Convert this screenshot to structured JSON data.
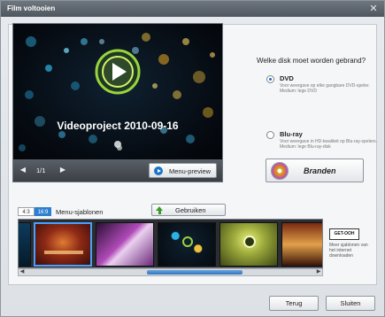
{
  "window": {
    "title": "Film voltooien",
    "close_glyph": "✕"
  },
  "preview": {
    "project_title": "Videoproject 2010-09-16",
    "page_counter": "1/1",
    "prev_glyph": "◀",
    "next_glyph": "▶",
    "menu_preview_label": "Menu-preview"
  },
  "disc": {
    "question": "Welke disk moet worden gebrand?",
    "options": [
      {
        "label": "DVD",
        "selected": true,
        "description": "Voor weergave op elke gangbare DVD-speler. Medium: lege DVD"
      },
      {
        "label": "Blu-ray",
        "selected": false,
        "description": "Voor weergave in HD-kwaliteit op Blu-ray-spelers. Medium: lege Blu-ray-disk"
      }
    ],
    "burn_label": "Branden"
  },
  "templates": {
    "aspect_43": "4:3",
    "aspect_169": "16:9",
    "label": "Menu-sjablonen",
    "use_label": "Gebruiken",
    "get_more_label": "GET-OOH",
    "get_more_desc": "Meer sjablonen van het internet downloaden",
    "scroll_left": "◀",
    "scroll_right": "▶"
  },
  "footer": {
    "back_label": "Terug",
    "close_label": "Sluiten"
  },
  "colors": {
    "accent": "#2d7fd0",
    "selection": "#4aa0ff",
    "titlebar": "#555c64"
  }
}
